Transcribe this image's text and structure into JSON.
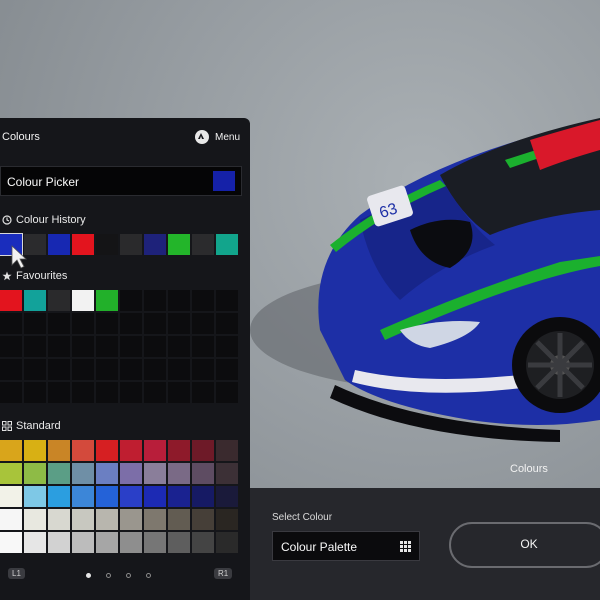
{
  "panel": {
    "title": "Colours",
    "menu_label": "Menu",
    "picker_label": "Colour Picker",
    "picker_color": "#1521a8",
    "history_label": "Colour History",
    "favourites_label": "Favourites",
    "standard_label": "Standard",
    "history": [
      "#1a2dbd",
      "#2b2b2d",
      "#1728b2",
      "#e3141e",
      "#141416",
      "#2a2a2c",
      "#1e227a",
      "#23b52a",
      "#2b2b2d",
      "#12a58c"
    ],
    "favourites": [
      "#e3141e",
      "#12a29a",
      "#2a2a2c",
      "#f2f2f2",
      "#22b02a",
      "",
      "",
      "",
      "",
      "",
      "",
      "",
      "",
      "",
      "",
      "",
      "",
      "",
      "",
      "",
      "",
      "",
      "",
      "",
      "",
      "",
      "",
      "",
      "",
      "",
      "",
      "",
      "",
      "",
      "",
      "",
      "",
      "",
      "",
      "",
      "",
      "",
      "",
      "",
      "",
      "",
      "",
      "",
      "",
      ""
    ],
    "standard": [
      "#d9a51b",
      "#d8b014",
      "#c98526",
      "#d34a3c",
      "#d61f22",
      "#bf1e30",
      "#b81e3a",
      "#8e1a2a",
      "#6e1a28",
      "#3a2a2e",
      "#a8c43a",
      "#8ebb46",
      "#5b9e86",
      "#6f8fa6",
      "#6b7fc2",
      "#7c6ea8",
      "#8a7e9a",
      "#7a6a86",
      "#5e4c62",
      "#3c3036",
      "#f2f2e8",
      "#7ec8e6",
      "#2b9ee0",
      "#3c86d8",
      "#2462d8",
      "#2a3fc8",
      "#1c2ab4",
      "#1a2290",
      "#161a64",
      "#1a1a3a",
      "#f6f6f6",
      "#e8e8e0",
      "#d8d8d0",
      "#c8c8c0",
      "#b8b6ae",
      "#9a968e",
      "#7e786e",
      "#625c52",
      "#463f38",
      "#2a2622",
      "#f8f8f8",
      "#e6e6e6",
      "#d2d2d2",
      "#bcbcbc",
      "#a6a6a6",
      "#8e8e8e",
      "#767676",
      "#5e5e5e",
      "#444444",
      "#2a2a2a"
    ],
    "pager_left": "L1",
    "pager_right": "R1",
    "pages": 4,
    "active_page": 0
  },
  "bottom": {
    "select_label": "Select Colour",
    "palette_label": "Colour Palette",
    "ok_label": "OK"
  },
  "view": {
    "label": "Colours"
  },
  "colors": {
    "panel_bg": "#15161a",
    "bar_bg": "#26272c",
    "car_blue": "#1d2fa6",
    "car_green": "#1bb02e",
    "car_red": "#d9182a"
  }
}
